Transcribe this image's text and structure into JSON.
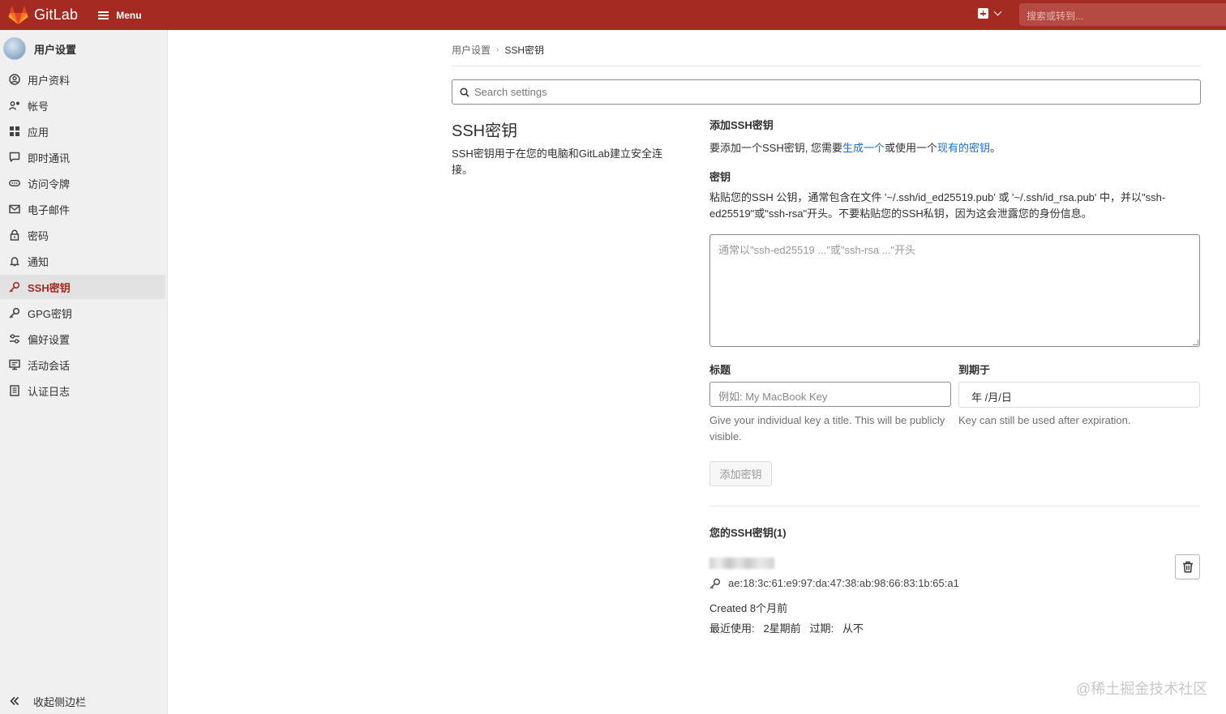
{
  "topbar": {
    "brand": "GitLab",
    "menu_label": "Menu",
    "search_placeholder": "搜索或转到..."
  },
  "sidebar": {
    "header_title": "用户设置",
    "items": [
      {
        "label": "用户资料",
        "icon": "profile-icon",
        "active": false
      },
      {
        "label": "帐号",
        "icon": "account-icon",
        "active": false
      },
      {
        "label": "应用",
        "icon": "applications-icon",
        "active": false
      },
      {
        "label": "即时通讯",
        "icon": "chat-icon",
        "active": false
      },
      {
        "label": "访问令牌",
        "icon": "token-icon",
        "active": false
      },
      {
        "label": "电子邮件",
        "icon": "mail-icon",
        "active": false
      },
      {
        "label": "密码",
        "icon": "lock-icon",
        "active": false
      },
      {
        "label": "通知",
        "icon": "bell-icon",
        "active": false
      },
      {
        "label": "SSH密钥",
        "icon": "key-icon",
        "active": true
      },
      {
        "label": "GPG密钥",
        "icon": "key-icon",
        "active": false
      },
      {
        "label": "偏好设置",
        "icon": "preferences-icon",
        "active": false
      },
      {
        "label": "活动会话",
        "icon": "monitor-icon",
        "active": false
      },
      {
        "label": "认证日志",
        "icon": "log-icon",
        "active": false
      }
    ],
    "collapse_label": "收起侧边栏"
  },
  "breadcrumb": {
    "parent": "用户设置",
    "separator": "›",
    "current": "SSH密钥"
  },
  "search": {
    "placeholder": "Search settings"
  },
  "section": {
    "title": "SSH密钥",
    "description": "SSH密钥用于在您的电脑和GitLab建立安全连接。"
  },
  "add_form": {
    "heading": "添加SSH密钥",
    "intro_prefix": "要添加一个SSH密钥, 您需要",
    "intro_link1": "生成一个",
    "intro_middle": "或使用一个",
    "intro_link2": "现有的密钥",
    "intro_suffix": "。",
    "key_label": "密钥",
    "key_help": "粘贴您的SSH 公钥，通常包含在文件 '~/.ssh/id_ed25519.pub' 或 '~/.ssh/id_rsa.pub' 中，并以\"ssh-ed25519\"或\"ssh-rsa\"开头。不要粘贴您的SSH私钥，因为这会泄露您的身份信息。",
    "key_placeholder": "通常以\"ssh-ed25519 ...\"或\"ssh-rsa ...\"开头",
    "title_label": "标题",
    "title_placeholder": "例如: My MacBook Key",
    "title_help": "Give your individual key a title. This will be publicly visible.",
    "expires_label": "到期于",
    "expires_value": "年 /月/日",
    "expires_help": "Key can still be used after expiration.",
    "submit_label": "添加密钥"
  },
  "keys": {
    "heading": "您的SSH密钥(1)",
    "list": [
      {
        "name": "key-name",
        "fingerprint": "ae:18:3c:61:e9:97:da:47:38:ab:98:66:83:1b:65:a1",
        "created": "Created 8个月前",
        "last_used": "最近使用:   2星期前   过期:   从不"
      }
    ]
  },
  "watermark": "@稀土掘金技术社区",
  "colors": {
    "topbar": "#a52a22",
    "link": "#1f6fbf",
    "sidebar_bg": "#f0f0f0",
    "active_text": "#a52a22"
  }
}
